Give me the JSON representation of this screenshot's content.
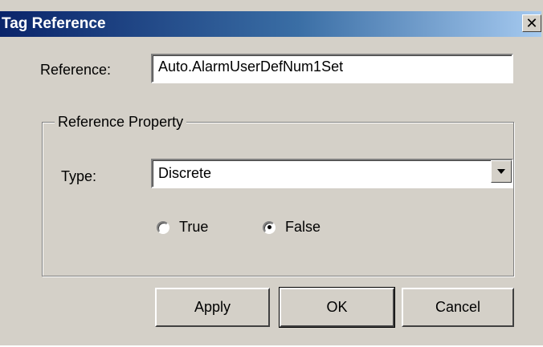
{
  "window": {
    "title": "Tag Reference",
    "close_glyph": "✕"
  },
  "reference": {
    "label": "Reference:",
    "value": "Auto.AlarmUserDefNum1Set"
  },
  "reference_property": {
    "title": "Reference Property",
    "type_label": "Type:",
    "type_value": "Discrete",
    "options": [
      {
        "label": "True",
        "selected": false
      },
      {
        "label": "False",
        "selected": true
      }
    ]
  },
  "buttons": {
    "apply": "Apply",
    "ok": "OK",
    "cancel": "Cancel"
  },
  "icons": {
    "close": "close-icon",
    "dropdown": "chevron-down-icon"
  }
}
